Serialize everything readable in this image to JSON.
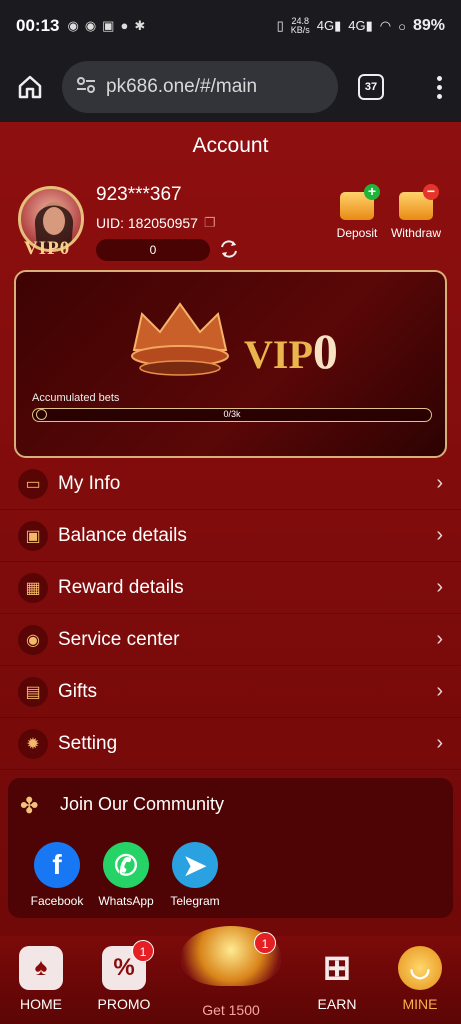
{
  "status": {
    "time": "00:13",
    "speed": "24.8",
    "speed_unit": "KB/s",
    "net1": "4G",
    "net2": "4G",
    "battery": "89%"
  },
  "browser": {
    "url": "pk686.one/#/main",
    "tab_count": "37"
  },
  "page": {
    "title": "Account"
  },
  "user": {
    "name": "923***367",
    "uid": "UID: 182050957",
    "balance": "0",
    "vip_tag": "VIP0"
  },
  "actions": {
    "deposit": "Deposit",
    "withdraw": "Withdraw"
  },
  "vip": {
    "prefix": "VIP",
    "level": "0",
    "acc_label": "Accumulated bets",
    "progress": "0/3k",
    "progress_fraction": 0
  },
  "menu": [
    {
      "label": "My Info",
      "icon": "id-card-icon"
    },
    {
      "label": "Balance details",
      "icon": "wallet-icon"
    },
    {
      "label": "Reward details",
      "icon": "gift-box-icon"
    },
    {
      "label": "Service center",
      "icon": "headset-icon"
    },
    {
      "label": "Gifts",
      "icon": "ticket-icon"
    },
    {
      "label": "Setting",
      "icon": "gear-icon"
    }
  ],
  "community": {
    "title": "Join Our Community",
    "items": [
      {
        "label": "Facebook",
        "color": "#1877f2"
      },
      {
        "label": "WhatsApp",
        "color": "#25d366"
      },
      {
        "label": "Telegram",
        "color": "#2aa1e0"
      }
    ]
  },
  "tabbar": {
    "home": "HOME",
    "promo": "PROMO",
    "promo_badge": "1",
    "get": "Get 1500",
    "get_badge": "1",
    "earn": "EARN",
    "mine": "MINE"
  },
  "colors": {
    "accent": "#f5c26b",
    "background": "#8e0f0f",
    "active_tab": "#f5b24a"
  }
}
